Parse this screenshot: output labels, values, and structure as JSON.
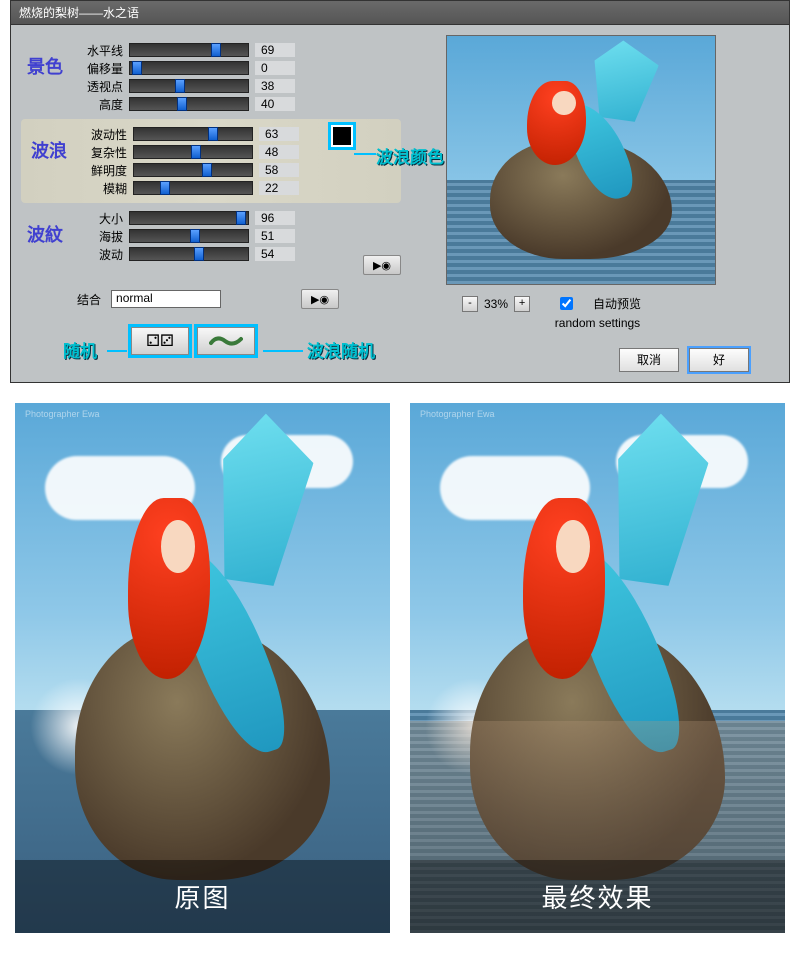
{
  "title": "燃烧的梨树——水之语",
  "sections": {
    "scene": {
      "title": "景色",
      "sliders": [
        {
          "label": "水平线",
          "value": 69,
          "pct": 69
        },
        {
          "label": "偏移量",
          "value": 0,
          "pct": 2
        },
        {
          "label": "透视点",
          "value": 38,
          "pct": 38
        },
        {
          "label": "高度",
          "value": 40,
          "pct": 40
        }
      ]
    },
    "wave": {
      "title": "波浪",
      "sliders": [
        {
          "label": "波动性",
          "value": 63,
          "pct": 63
        },
        {
          "label": "复杂性",
          "value": 48,
          "pct": 48
        },
        {
          "label": "鲜明度",
          "value": 58,
          "pct": 58
        },
        {
          "label": "模糊",
          "value": 22,
          "pct": 22
        }
      ]
    },
    "ripple": {
      "title": "波紋",
      "sliders": [
        {
          "label": "大小",
          "value": 96,
          "pct": 96
        },
        {
          "label": "海拔",
          "value": 51,
          "pct": 51
        },
        {
          "label": "波动",
          "value": 54,
          "pct": 54
        }
      ]
    }
  },
  "wave_color_label": "波浪颜色",
  "wave_color": "#000000",
  "combine": {
    "label": "结合",
    "mode": "normal"
  },
  "random_label": "随机",
  "wave_random_label": "波浪随机",
  "zoom": {
    "pct": "33%"
  },
  "auto_preview_label": "自动预览",
  "random_settings": "random settings",
  "buttons": {
    "cancel": "取消",
    "ok": "好"
  },
  "comparison": {
    "original": "原图",
    "final": "最终效果"
  },
  "photog": "Photographer  Ewa"
}
